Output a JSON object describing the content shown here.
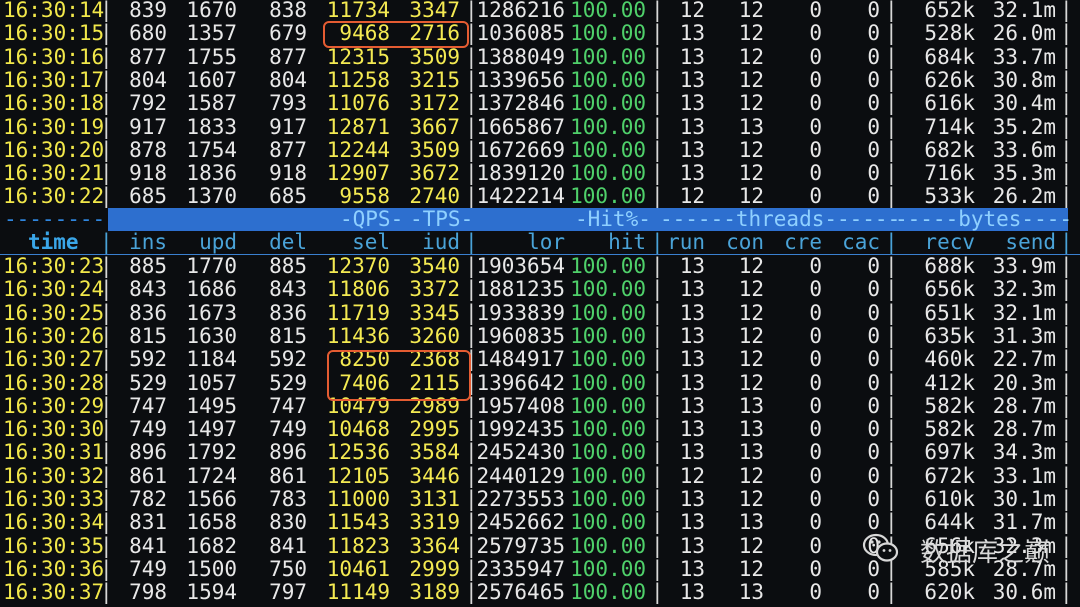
{
  "terminal": {
    "header_separator": {
      "left_dash": "--------",
      "qps": "-QPS-",
      "tps": "-TPS-",
      "hit": "-Hit%-",
      "threads": "------threads------",
      "bytes": "-----bytes----"
    },
    "columns": [
      "time",
      "ins",
      "upd",
      "del",
      "sel",
      "iud",
      "lor",
      "hit",
      "run",
      "con",
      "cre",
      "cac",
      "recv",
      "send"
    ],
    "rows_before": [
      [
        "16:30:14",
        "839",
        "1670",
        "838",
        "11734",
        "3347",
        "1286216",
        "100.00",
        "12",
        "12",
        "0",
        "0",
        "652k",
        "32.1m"
      ],
      [
        "16:30:15",
        "680",
        "1357",
        "679",
        "9468",
        "2716",
        "1036085",
        "100.00",
        "13",
        "12",
        "0",
        "0",
        "528k",
        "26.0m"
      ],
      [
        "16:30:16",
        "877",
        "1755",
        "877",
        "12315",
        "3509",
        "1388049",
        "100.00",
        "13",
        "12",
        "0",
        "0",
        "684k",
        "33.7m"
      ],
      [
        "16:30:17",
        "804",
        "1607",
        "804",
        "11258",
        "3215",
        "1339656",
        "100.00",
        "13",
        "12",
        "0",
        "0",
        "626k",
        "30.8m"
      ],
      [
        "16:30:18",
        "792",
        "1587",
        "793",
        "11076",
        "3172",
        "1372846",
        "100.00",
        "13",
        "12",
        "0",
        "0",
        "616k",
        "30.4m"
      ],
      [
        "16:30:19",
        "917",
        "1833",
        "917",
        "12871",
        "3667",
        "1665867",
        "100.00",
        "13",
        "13",
        "0",
        "0",
        "714k",
        "35.2m"
      ],
      [
        "16:30:20",
        "878",
        "1754",
        "877",
        "12244",
        "3509",
        "1672669",
        "100.00",
        "13",
        "12",
        "0",
        "0",
        "682k",
        "33.6m"
      ],
      [
        "16:30:21",
        "918",
        "1836",
        "918",
        "12907",
        "3672",
        "1839120",
        "100.00",
        "13",
        "12",
        "0",
        "0",
        "716k",
        "35.3m"
      ],
      [
        "16:30:22",
        "685",
        "1370",
        "685",
        "9558",
        "2740",
        "1422214",
        "100.00",
        "12",
        "12",
        "0",
        "0",
        "533k",
        "26.2m"
      ]
    ],
    "rows_after": [
      [
        "16:30:23",
        "885",
        "1770",
        "885",
        "12370",
        "3540",
        "1903654",
        "100.00",
        "13",
        "12",
        "0",
        "0",
        "688k",
        "33.9m"
      ],
      [
        "16:30:24",
        "843",
        "1686",
        "843",
        "11806",
        "3372",
        "1881235",
        "100.00",
        "13",
        "12",
        "0",
        "0",
        "656k",
        "32.3m"
      ],
      [
        "16:30:25",
        "836",
        "1673",
        "836",
        "11719",
        "3345",
        "1933839",
        "100.00",
        "13",
        "12",
        "0",
        "0",
        "651k",
        "32.1m"
      ],
      [
        "16:30:26",
        "815",
        "1630",
        "815",
        "11436",
        "3260",
        "1960835",
        "100.00",
        "13",
        "12",
        "0",
        "0",
        "635k",
        "31.3m"
      ],
      [
        "16:30:27",
        "592",
        "1184",
        "592",
        "8250",
        "2368",
        "1484917",
        "100.00",
        "13",
        "12",
        "0",
        "0",
        "460k",
        "22.7m"
      ],
      [
        "16:30:28",
        "529",
        "1057",
        "529",
        "7406",
        "2115",
        "1396642",
        "100.00",
        "13",
        "12",
        "0",
        "0",
        "412k",
        "20.3m"
      ],
      [
        "16:30:29",
        "747",
        "1495",
        "747",
        "10479",
        "2989",
        "1957408",
        "100.00",
        "13",
        "13",
        "0",
        "0",
        "582k",
        "28.7m"
      ],
      [
        "16:30:30",
        "749",
        "1497",
        "749",
        "10468",
        "2995",
        "1992435",
        "100.00",
        "13",
        "13",
        "0",
        "0",
        "582k",
        "28.7m"
      ],
      [
        "16:30:31",
        "896",
        "1792",
        "896",
        "12536",
        "3584",
        "2452430",
        "100.00",
        "13",
        "13",
        "0",
        "0",
        "697k",
        "34.3m"
      ],
      [
        "16:30:32",
        "861",
        "1724",
        "861",
        "12105",
        "3446",
        "2440129",
        "100.00",
        "12",
        "12",
        "0",
        "0",
        "672k",
        "33.1m"
      ],
      [
        "16:30:33",
        "782",
        "1566",
        "783",
        "11000",
        "3131",
        "2273553",
        "100.00",
        "13",
        "12",
        "0",
        "0",
        "610k",
        "30.1m"
      ],
      [
        "16:30:34",
        "831",
        "1658",
        "830",
        "11543",
        "3319",
        "2452662",
        "100.00",
        "13",
        "13",
        "0",
        "0",
        "644k",
        "31.7m"
      ],
      [
        "16:30:35",
        "841",
        "1682",
        "841",
        "11823",
        "3364",
        "2579735",
        "100.00",
        "13",
        "12",
        "0",
        "0",
        "656k",
        "32.3m"
      ],
      [
        "16:30:36",
        "749",
        "1500",
        "750",
        "10461",
        "2999",
        "2335947",
        "100.00",
        "13",
        "12",
        "0",
        "0",
        "585k",
        "28.7m"
      ],
      [
        "16:30:37",
        "798",
        "1594",
        "797",
        "11149",
        "3189",
        "2576465",
        "100.00",
        "13",
        "13",
        "0",
        "0",
        "620k",
        "30.6m"
      ]
    ]
  },
  "watermark": {
    "text": "数据库之巅",
    "icon": "wechat-icon"
  },
  "colors": {
    "background": "#0b0d10",
    "time": "#f2e84a",
    "plain_number": "#e8e8e8",
    "qps_tps_number": "#f4ea52",
    "hit_number": "#4fd06a",
    "header": "#4aa3d8",
    "separator_bar": "#2d6fcf",
    "highlight_box": "#e55c32"
  }
}
